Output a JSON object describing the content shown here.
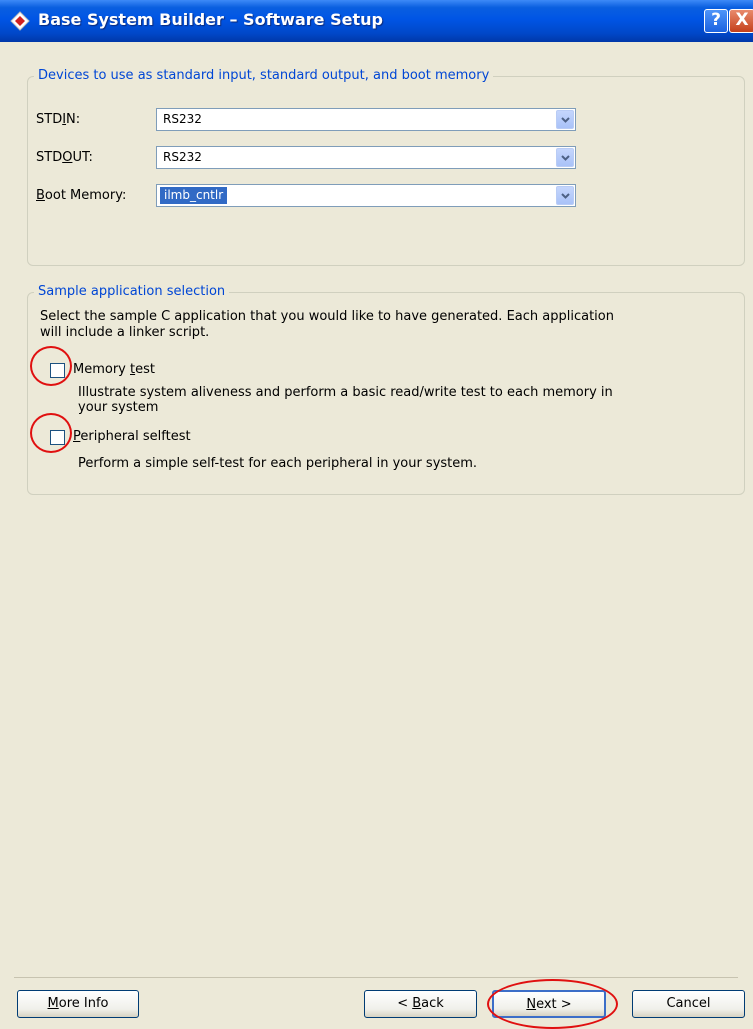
{
  "window": {
    "title": "Base System Builder – Software Setup",
    "help_button": "?",
    "close_button": "X"
  },
  "devices_group": {
    "title": "Devices to use as standard input, standard output, and boot memory",
    "stdin": {
      "label_pre": "STD",
      "label_accel": "I",
      "label_post": "N:",
      "value": "RS232"
    },
    "stdout": {
      "label_pre": "STD",
      "label_accel": "O",
      "label_post": "UT:",
      "value": "RS232"
    },
    "boot_memory": {
      "label_pre": "",
      "label_accel": "B",
      "label_post": "oot Memory:",
      "value": "ilmb_cntlr"
    }
  },
  "sample_group": {
    "title": "Sample application selection",
    "description_line1": "Select the sample C application that you would like to have generated.  Each application",
    "description_line2": "will include a linker script.",
    "memory_test": {
      "label_pre": "Memory ",
      "label_accel": "t",
      "label_post": "est",
      "checked": false,
      "desc_line1": "Illustrate system aliveness and perform a basic read/write test to each memory in",
      "desc_line2": "your system"
    },
    "peripheral_selftest": {
      "label_pre": "",
      "label_accel": "P",
      "label_post": "eripheral selftest",
      "checked": false,
      "desc_line1": "Perform a simple self-test for each peripheral in your system."
    }
  },
  "buttons": {
    "more_info": {
      "accel": "M",
      "rest": "ore Info"
    },
    "back": {
      "pre": "< ",
      "accel": "B",
      "rest": "ack"
    },
    "next": {
      "accel": "N",
      "rest": "ext >"
    },
    "cancel": {
      "label": "Cancel"
    }
  },
  "colors": {
    "titlebar": "#0055e5",
    "group_title": "#0046d5",
    "annotation_circle": "#e01010",
    "selection": "#316ac5"
  }
}
